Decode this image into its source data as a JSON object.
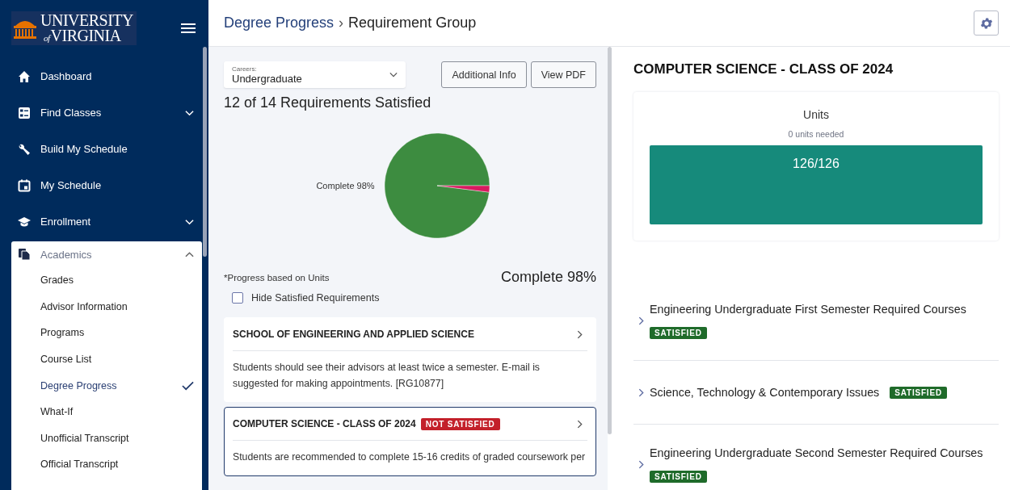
{
  "logo": {
    "line1": "UNIVERSITY",
    "of": "of",
    "line2": "VIRGINIA"
  },
  "nav": [
    {
      "label": "Dashboard"
    },
    {
      "label": "Find Classes",
      "expanded": false
    },
    {
      "label": "Build My Schedule"
    },
    {
      "label": "My Schedule"
    },
    {
      "label": "Enrollment",
      "expanded": false
    },
    {
      "label": "Academics",
      "expanded": true,
      "children": [
        {
          "label": "Grades",
          "selected": false
        },
        {
          "label": "Advisor Information",
          "selected": false
        },
        {
          "label": "Programs",
          "selected": false
        },
        {
          "label": "Course List",
          "selected": false
        },
        {
          "label": "Degree Progress",
          "selected": true
        },
        {
          "label": "What-If",
          "selected": false
        },
        {
          "label": "Unofficial Transcript",
          "selected": false
        },
        {
          "label": "Official Transcript",
          "selected": false
        }
      ]
    }
  ],
  "breadcrumb": {
    "separator": "›",
    "items": [
      "Degree Progress",
      "Requirement Group"
    ]
  },
  "careers": {
    "label": "Careers:",
    "value": "Undergraduate"
  },
  "buttons": [
    "Additional Info",
    "View PDF"
  ],
  "summary": "12 of 14 Requirements Satisfied",
  "chart_data": {
    "type": "pie",
    "values": [
      98,
      2
    ],
    "colors": [
      "#3d8c40",
      "#d81b60"
    ],
    "annotations": [
      {
        "text": "Complete 98%"
      }
    ]
  },
  "progress_note": "*Progress based on Units",
  "progress_total": "Complete 98%",
  "hide_satisfied": {
    "label": "Hide Satisfied Requirements",
    "checked": false
  },
  "groups": [
    {
      "title": "SCHOOL OF ENGINEERING AND APPLIED SCIENCE",
      "selected": false,
      "description": "Students should see their advisors at least twice a semester. E-mail is suggested for making appointments. [RG10877]"
    },
    {
      "title": "COMPUTER SCIENCE - CLASS OF 2024",
      "selected": true,
      "status": {
        "kind": "not_satisfied",
        "label": "NOT SATISFIED"
      },
      "description": "Students are recommended to complete 15-16 credits of graded coursework per"
    }
  ],
  "detail": {
    "title": "COMPUTER SCIENCE - CLASS OF 2024",
    "units": {
      "label": "Units",
      "needed": "0 units needed",
      "reading": "126/126",
      "level": 1
    },
    "requirements": [
      {
        "title": "Engineering Undergraduate First Semester Required Courses",
        "kind": "stacked",
        "status": {
          "kind": "satisfied",
          "label": "SATISFIED"
        }
      },
      {
        "title": "Science, Technology & Contemporary Issues",
        "kind": "inline",
        "status": {
          "kind": "satisfied",
          "label": "SATISFIED"
        }
      },
      {
        "title": "Engineering Undergraduate Second Semester Required Courses",
        "kind": "stacked",
        "status": {
          "kind": "satisfied",
          "label": "SATISFIED"
        }
      }
    ]
  }
}
